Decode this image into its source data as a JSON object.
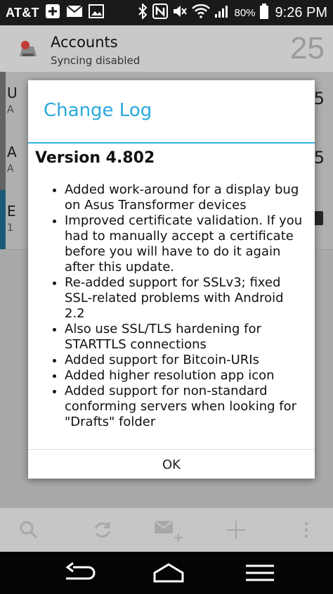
{
  "status_bar": {
    "carrier": "AT&T",
    "battery": "80%",
    "time": "9:26 PM"
  },
  "header": {
    "title": "Accounts",
    "subtitle": "Syncing disabled",
    "count": "25"
  },
  "accounts": [
    {
      "letter": "U",
      "sub": "A",
      "count": "5"
    },
    {
      "letter": "A",
      "sub": "A",
      "count": "5"
    },
    {
      "letter": "E",
      "sub": "1",
      "count": ""
    }
  ],
  "dialog": {
    "title": "Change Log",
    "version": "Version 4.802",
    "changes": [
      "Added work-around for a display bug on Asus Transformer devices",
      "Improved certificate validation. If you had to manually accept a certificate before you will have to do it again after this update.",
      "Re-added support for SSLv3; fixed SSL-related problems with Android 2.2",
      "Also use SSL/TLS hardening for STARTTLS connections",
      "Added support for Bitcoin-URIs",
      "Added higher resolution app icon",
      "Added support for non-standard conforming servers when looking for \"Drafts\" folder"
    ],
    "ok_label": "OK"
  },
  "colors": {
    "accent": "#33b5e5",
    "selected_bar": "#1f6f90"
  }
}
